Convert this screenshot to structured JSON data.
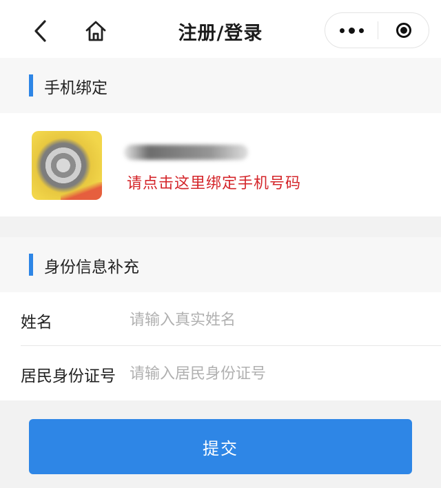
{
  "navbar": {
    "title": "注册/登录",
    "back_icon": "chevron-left-icon",
    "home_icon": "home-icon",
    "more_icon": "more-dots-icon",
    "close_icon": "target-close-icon"
  },
  "phone_section": {
    "title": "手机绑定",
    "bind_prompt": "请点击这里绑定手机号码"
  },
  "identity_section": {
    "title": "身份信息补充",
    "fields": [
      {
        "label": "姓名",
        "placeholder": "请输入真实姓名",
        "value": ""
      },
      {
        "label": "居民身份证号",
        "placeholder": "请输入居民身份证号",
        "value": ""
      }
    ]
  },
  "submit_label": "提交",
  "colors": {
    "accent": "#2e86e6",
    "warning_text": "#d4252a",
    "background": "#f2f2f2"
  }
}
